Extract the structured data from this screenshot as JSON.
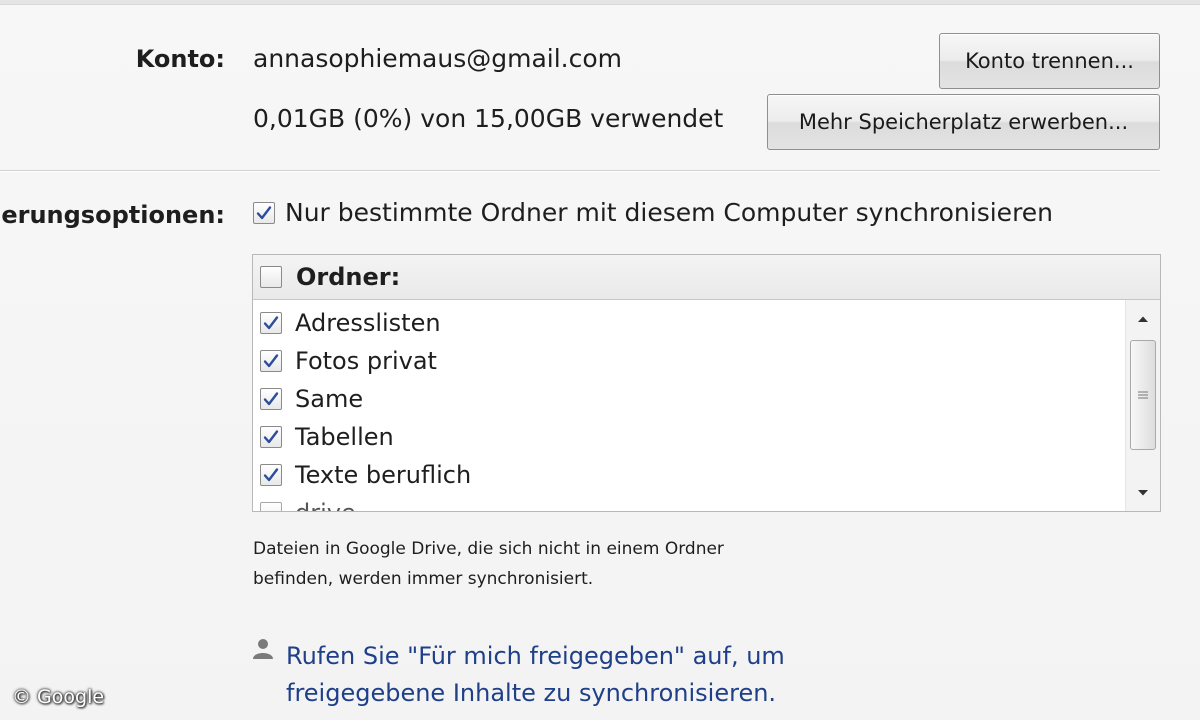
{
  "account": {
    "label": "Konto:",
    "email": "annasophiemaus@gmail.com",
    "disconnect_button": "Konto trennen...",
    "storage_usage": "0,01GB (0%) von 15,00GB verwendet",
    "buy_storage_button": "Mehr Speicherplatz erwerben..."
  },
  "sync_options": {
    "label": "erungsoptionen:",
    "only_selected_folders": {
      "text": "Nur bestimmte Ordner mit diesem Computer synchronisieren",
      "checked": true
    }
  },
  "folder_list": {
    "header": "Ordner:",
    "header_checked": false,
    "folders": [
      {
        "name": "Adresslisten",
        "checked": true
      },
      {
        "name": "Fotos privat",
        "checked": true
      },
      {
        "name": "Same",
        "checked": true
      },
      {
        "name": "Tabellen",
        "checked": true
      },
      {
        "name": "Texte beruflich",
        "checked": true
      },
      {
        "name": "drive",
        "checked": false
      }
    ]
  },
  "note": {
    "line1": "Dateien in Google Drive, die sich nicht in einem Ordner",
    "line2": "befinden, werden immer synchronisiert."
  },
  "shared": {
    "icon": "person-icon",
    "line1": "Rufen Sie \"Für mich freigegeben\" auf, um",
    "line2": "freigegebene Inhalte zu synchronisieren."
  },
  "watermark": "© Google",
  "colors": {
    "link": "#1f3f88",
    "checkmark": "#2a4d9c",
    "background": "#f6f6f6"
  }
}
